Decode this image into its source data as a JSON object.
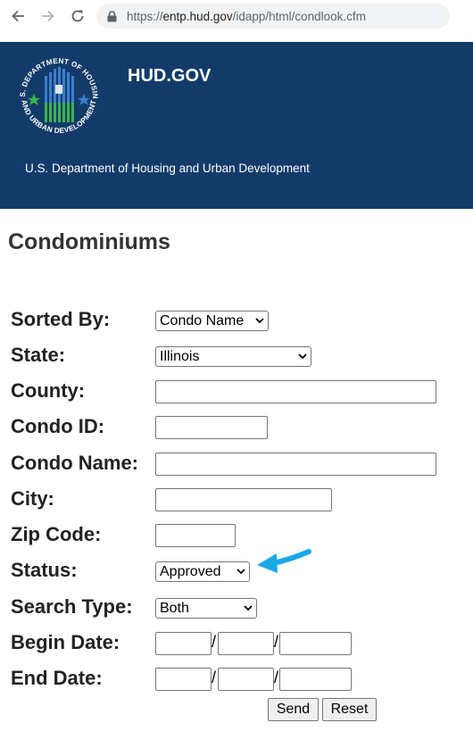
{
  "browser": {
    "url_host": "entp.hud.gov",
    "url_path": "/idapp/html/condlook.cfm",
    "url_scheme": "https://"
  },
  "header": {
    "site_name": "HUD.GOV",
    "subtitle": "U.S. Department of Housing and Urban Development",
    "seal_text_top": "U.S. DEPARTMENT OF HOUSING",
    "seal_text_bottom": "AND URBAN DEVELOPMENT",
    "colors": {
      "banner": "#133b6a",
      "seal_blue": "#3a7fd0",
      "seal_green": "#39b54a"
    }
  },
  "page": {
    "title": "Condominiums"
  },
  "form": {
    "sorted_by": {
      "label": "Sorted By:",
      "value": "Condo Name"
    },
    "state": {
      "label": "State:",
      "value": "Illinois"
    },
    "county": {
      "label": "County:",
      "value": ""
    },
    "condo_id": {
      "label": "Condo ID:",
      "value": ""
    },
    "condo_name": {
      "label": "Condo Name:",
      "value": ""
    },
    "city": {
      "label": "City:",
      "value": ""
    },
    "zip_code": {
      "label": "Zip Code:",
      "value": ""
    },
    "status": {
      "label": "Status:",
      "value": "Approved"
    },
    "search_type": {
      "label": "Search Type:",
      "value": "Both"
    },
    "begin_date": {
      "label": "Begin Date:",
      "separator": "/"
    },
    "end_date": {
      "label": "End Date:",
      "separator": "/"
    },
    "send_label": "Send",
    "reset_label": "Reset"
  },
  "annotation": {
    "arrow_color": "#1aa8e8"
  }
}
